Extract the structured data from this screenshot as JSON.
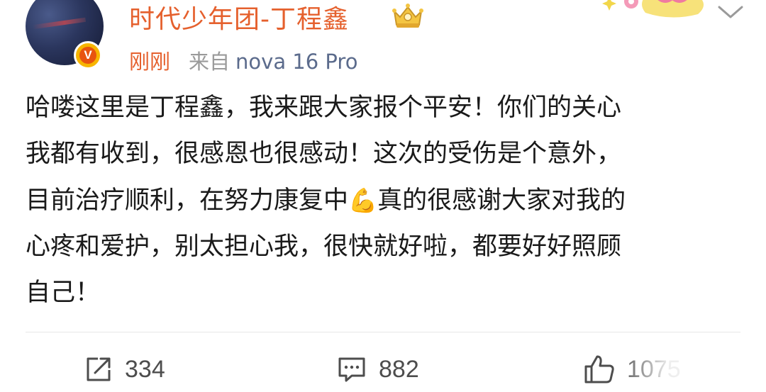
{
  "post": {
    "username": "时代少年团-丁程鑫",
    "time": "刚刚",
    "source_prefix": "来自",
    "device": "nova 16 Pro",
    "verified_badge": "V",
    "text_lines": [
      "哈喽这里是丁程鑫，我来跟大家报个平安！你们的关心",
      "我都有收到，很感恩也很感动！这次的受伤是个意外，",
      "目前治疗顺利，在努力康复中",
      "心疼和爱护，别太担心我，很快就好啦，都要好好照顾",
      "自己！"
    ],
    "emoji": "💪",
    "line3_tail": "真的很感谢大家对我的"
  },
  "actions": {
    "repost_count": "334",
    "comment_count": "882",
    "like_count": "1075"
  },
  "icons": {
    "avatar": "avatar",
    "verified": "verified-v-icon",
    "crown": "crown-badge-icon",
    "sticker": "decor-sticker",
    "more": "chevron-down-icon",
    "repost": "share-icon",
    "comment": "comment-icon",
    "like": "thumbs-up-icon"
  },
  "colors": {
    "accent": "#e5602d",
    "muted": "#9a9a9a",
    "device": "#5b6b8c",
    "badge": "#f7b500"
  }
}
